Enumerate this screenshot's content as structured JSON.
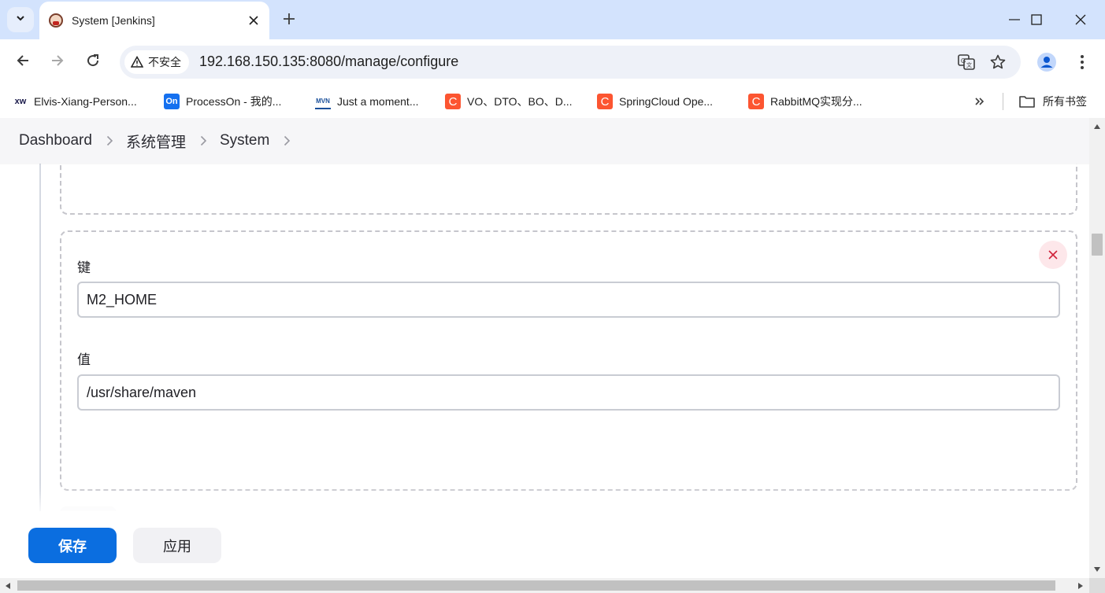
{
  "browser": {
    "tab": {
      "title": "System [Jenkins]"
    },
    "security_label": "不安全",
    "url": "192.168.150.135:8080/manage/configure",
    "bookmarks": [
      {
        "label": "Elvis-Xiang-Person...",
        "icon": "xw-logo-icon",
        "icon_text": "xw"
      },
      {
        "label": "ProcessOn - 我的...",
        "icon": "processon-logo-icon",
        "icon_text": "On"
      },
      {
        "label": "Just a moment...",
        "icon": "mvn-logo-icon",
        "icon_text": "MVN"
      },
      {
        "label": "VO、DTO、BO、D...",
        "icon": "csdn-logo-icon",
        "icon_text": "C"
      },
      {
        "label": "SpringCloud Ope...",
        "icon": "csdn-logo-icon",
        "icon_text": "C"
      },
      {
        "label": "RabbitMQ实现分...",
        "icon": "csdn-logo-icon",
        "icon_text": "C"
      }
    ],
    "all_bookmarks_label": "所有书签"
  },
  "breadcrumb": [
    "Dashboard",
    "系统管理",
    "System"
  ],
  "env_var": {
    "key_label": "键",
    "key_value": "M2_HOME",
    "value_label": "值",
    "value_value": "/usr/share/maven"
  },
  "actions": {
    "save": "保存",
    "apply": "应用"
  },
  "colors": {
    "primary": "#0b6ee0",
    "danger": "#d0243b",
    "tabstrip": "#d3e3fd"
  }
}
